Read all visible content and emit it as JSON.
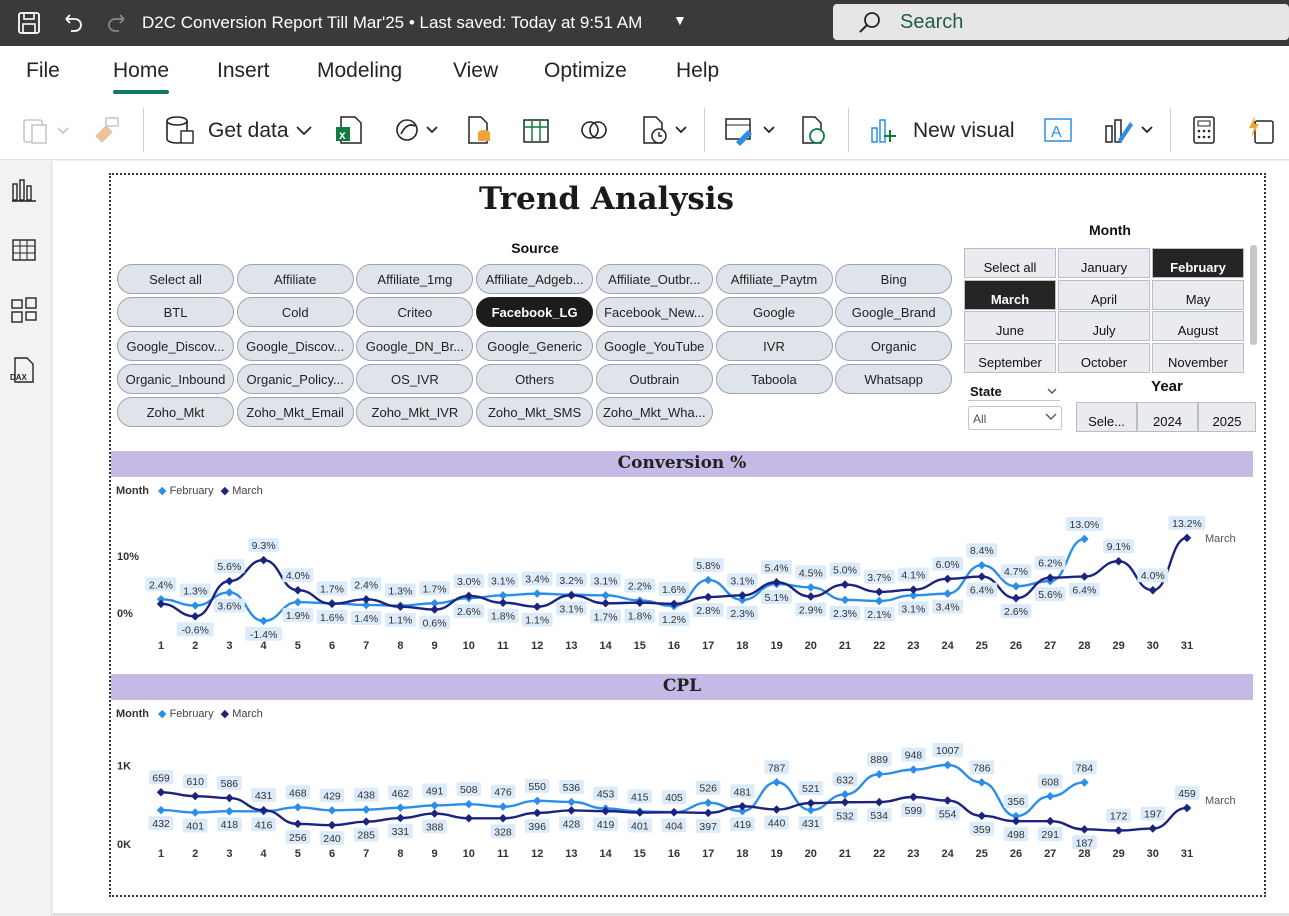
{
  "titlebar": {
    "doc_title": "D2C Conversion Report Till Mar'25 • Last saved: Today at 9:51 AM",
    "search_placeholder": "Search"
  },
  "menu": [
    "File",
    "Home",
    "Insert",
    "Modeling",
    "View",
    "Optimize",
    "Help"
  ],
  "ribbon": {
    "get_data": "Get data",
    "new_visual": "New visual"
  },
  "report": {
    "title": "Trend Analysis",
    "source": {
      "title": "Source",
      "selected": "Facebook_LG",
      "items": [
        "Select all",
        "Affiliate",
        "Affiliate_1mg",
        "Affiliate_Adgeb...",
        "Affiliate_Outbr...",
        "Affiliate_Paytm",
        "Bing",
        "BTL",
        "Cold",
        "Criteo",
        "Facebook_LG",
        "Facebook_New...",
        "Google",
        "Google_Brand",
        "Google_Discov...",
        "Google_Discov...",
        "Google_DN_Br...",
        "Google_Generic",
        "Google_YouTube",
        "IVR",
        "Organic",
        "Organic_Inbound",
        "Organic_Policy...",
        "OS_IVR",
        "Others",
        "Outbrain",
        "Taboola",
        "Whatsapp",
        "Zoho_Mkt",
        "Zoho_Mkt_Email",
        "Zoho_Mkt_IVR",
        "Zoho_Mkt_SMS",
        "Zoho_Mkt_Wha..."
      ]
    },
    "month": {
      "title": "Month",
      "items": [
        "Select all",
        "January",
        "February",
        "March",
        "April",
        "May",
        "June",
        "July",
        "August",
        "September",
        "October",
        "November"
      ],
      "selected": [
        "February",
        "March"
      ]
    },
    "state": {
      "title": "State",
      "value": "All"
    },
    "year": {
      "title": "Year",
      "items": [
        "Sele...",
        "2024",
        "2025"
      ]
    },
    "conversion": {
      "title": "Conversion %",
      "legend_title": "Month",
      "series_end_label": "March"
    },
    "cpl": {
      "title": "CPL",
      "legend_title": "Month",
      "series_end_label": "March"
    }
  },
  "colors": {
    "february": "#2b8ee8",
    "march": "#1a237e",
    "band": "#c5b9e6",
    "label_bg": "#dcebfa"
  },
  "chart_data": [
    {
      "type": "line",
      "title": "Conversion %",
      "x": [
        1,
        2,
        3,
        4,
        5,
        6,
        7,
        8,
        9,
        10,
        11,
        12,
        13,
        14,
        15,
        16,
        17,
        18,
        19,
        20,
        21,
        22,
        23,
        24,
        25,
        26,
        27,
        28,
        29,
        30,
        31
      ],
      "yticks": [
        "0%",
        "10%"
      ],
      "ylim": [
        -3,
        16
      ],
      "series": [
        {
          "name": "February",
          "values": [
            2.4,
            1.3,
            3.6,
            -1.4,
            1.9,
            1.7,
            1.4,
            1.3,
            1.7,
            2.6,
            3.1,
            3.4,
            3.2,
            3.1,
            2.2,
            1.2,
            5.8,
            2.3,
            5.1,
            4.5,
            2.3,
            2.1,
            3.1,
            3.4,
            8.4,
            4.7,
            5.6,
            13.0,
            null,
            null,
            null
          ],
          "labels": [
            "2.4%",
            "1.3%",
            "3.6%",
            "-1.4%",
            "1.9%",
            "1.7%",
            "1.4%",
            "1.3%",
            "1.7%",
            "2.6%",
            "3.1%",
            "3.4%",
            "3.2%",
            "3.1%",
            "2.2%",
            "1.2%",
            "5.8%",
            "2.3%",
            "5.1%",
            "4.5%",
            "2.3%",
            "2.1%",
            "3.1%",
            "3.4%",
            "8.4%",
            "4.7%",
            "5.6%",
            "13.0%",
            null,
            null,
            null
          ]
        },
        {
          "name": "March",
          "values": [
            1.6,
            -0.6,
            5.6,
            9.3,
            4.0,
            1.6,
            2.4,
            1.1,
            0.6,
            3.0,
            1.8,
            1.1,
            3.1,
            1.7,
            1.8,
            1.6,
            2.8,
            3.1,
            5.4,
            2.9,
            5.0,
            3.7,
            4.1,
            6.0,
            6.4,
            2.6,
            6.2,
            6.4,
            9.1,
            4.0,
            13.2
          ],
          "labels": [
            null,
            "-0.6%",
            "5.6%",
            "9.3%",
            "4.0%",
            "1.6%",
            "2.4%",
            "1.1%",
            "0.6%",
            "3.0%",
            "1.8%",
            "1.1%",
            "3.1%",
            "1.7%",
            "1.8%",
            "1.6%",
            "2.8%",
            "3.1%",
            "5.4%",
            "2.9%",
            "5.0%",
            "3.7%",
            "4.1%",
            "6.0%",
            "6.4%",
            "2.6%",
            "6.2%",
            "6.4%",
            "9.1%",
            "4.0%",
            "13.2%"
          ]
        }
      ]
    },
    {
      "type": "line",
      "title": "CPL",
      "x": [
        1,
        2,
        3,
        4,
        5,
        6,
        7,
        8,
        9,
        10,
        11,
        12,
        13,
        14,
        15,
        16,
        17,
        18,
        19,
        20,
        21,
        22,
        23,
        24,
        25,
        26,
        27,
        28,
        29,
        30,
        31
      ],
      "yticks": [
        "0K",
        "1K"
      ],
      "ylim": [
        0,
        1300
      ],
      "series": [
        {
          "name": "February",
          "values": [
            432,
            401,
            418,
            416,
            468,
            429,
            438,
            462,
            491,
            508,
            476,
            550,
            536,
            453,
            415,
            405,
            526,
            419,
            787,
            431,
            632,
            889,
            948,
            1007,
            786,
            356,
            608,
            784,
            null,
            null,
            null
          ],
          "labels": [
            "432",
            "401",
            "418",
            "416",
            "468",
            "429",
            "438",
            "462",
            "491",
            "508",
            "476",
            "550",
            "536",
            "453",
            "415",
            "405",
            "526",
            "419",
            "787",
            "431",
            "632",
            "889",
            "948",
            "1007",
            "786",
            "356",
            "608",
            "784",
            null,
            null,
            null
          ]
        },
        {
          "name": "March",
          "values": [
            659,
            610,
            586,
            431,
            256,
            240,
            285,
            331,
            388,
            328,
            328,
            396,
            428,
            419,
            401,
            404,
            397,
            481,
            440,
            521,
            532,
            534,
            599,
            554,
            359,
            291,
            291,
            187,
            172,
            197,
            459
          ],
          "labels": [
            "659",
            "610",
            "586",
            "431",
            "256",
            "240",
            "285",
            "331",
            "388",
            null,
            "328",
            "396",
            "428",
            "419",
            "401",
            "404",
            "397",
            "481",
            "440",
            "521",
            "532",
            "534",
            "599",
            "554",
            "359",
            "498",
            "291",
            "187",
            "172",
            "197",
            "459"
          ]
        }
      ]
    }
  ]
}
